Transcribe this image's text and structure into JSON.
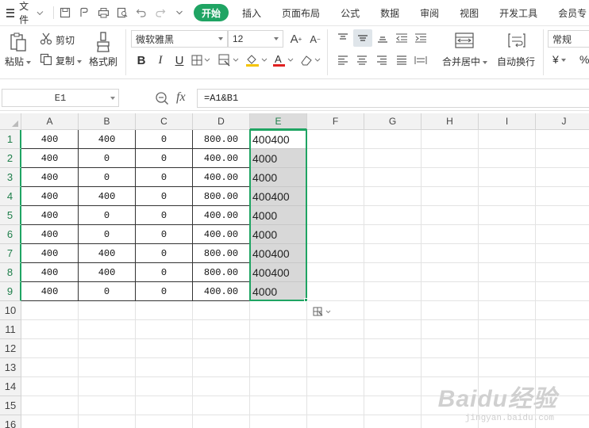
{
  "menu": {
    "file_label": "文件",
    "tabs": [
      "开始",
      "插入",
      "页面布局",
      "公式",
      "数据",
      "审阅",
      "视图",
      "开发工具",
      "会员专"
    ]
  },
  "ribbon": {
    "paste": "粘贴",
    "cut": "剪切",
    "copy": "复制",
    "format_painter": "格式刷",
    "font_name": "微软雅黑",
    "font_size": "12",
    "merge_center": "合并居中",
    "wrap_text": "自动换行",
    "number_format": "常规",
    "currency_symbol": "¥",
    "percent_symbol": "%"
  },
  "formula_bar": {
    "name_box": "E1",
    "fx_label": "fx",
    "formula": "=A1&B1"
  },
  "grid": {
    "columns": [
      "A",
      "B",
      "C",
      "D",
      "E",
      "F",
      "G",
      "H",
      "I",
      "J"
    ],
    "rows": [
      "1",
      "2",
      "3",
      "4",
      "5",
      "6",
      "7",
      "8",
      "9",
      "10",
      "11",
      "12",
      "13",
      "14",
      "15",
      "16"
    ],
    "data": [
      [
        "400",
        "400",
        "0",
        "800.00",
        "400400"
      ],
      [
        "400",
        "0",
        "0",
        "400.00",
        "4000"
      ],
      [
        "400",
        "0",
        "0",
        "400.00",
        "4000"
      ],
      [
        "400",
        "400",
        "0",
        "800.00",
        "400400"
      ],
      [
        "400",
        "0",
        "0",
        "400.00",
        "4000"
      ],
      [
        "400",
        "0",
        "0",
        "400.00",
        "4000"
      ],
      [
        "400",
        "400",
        "0",
        "800.00",
        "400400"
      ],
      [
        "400",
        "400",
        "0",
        "800.00",
        "400400"
      ],
      [
        "400",
        "0",
        "0",
        "400.00",
        "4000"
      ]
    ]
  },
  "watermark": {
    "logo": "Baidu经验",
    "url": "jingyan.baidu.com"
  },
  "colors": {
    "accent": "#1fa463",
    "selection_fill": "#d8d8d8"
  }
}
